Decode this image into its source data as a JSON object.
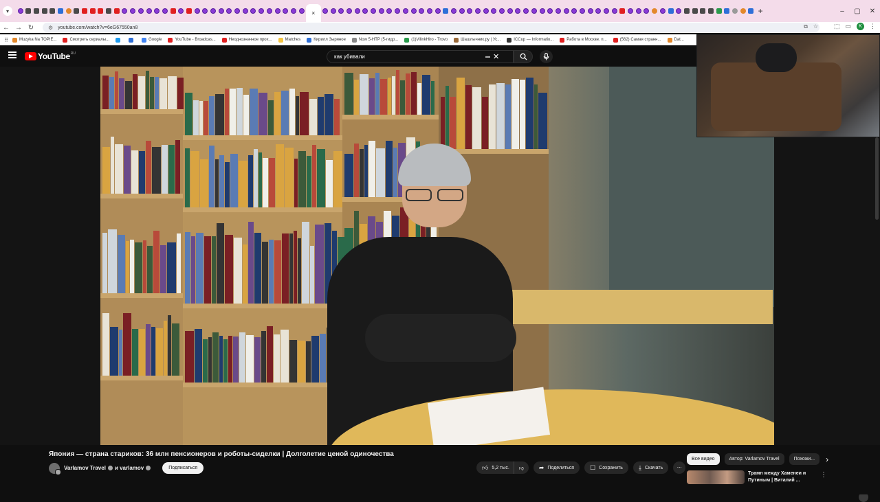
{
  "browser": {
    "tab_favicons": [
      "twitch",
      "doc",
      "doc",
      "doc",
      "doc",
      "blue",
      "orange",
      "doc",
      "yt",
      "yt",
      "yt",
      "doc",
      "yt",
      "twitch",
      "twitch",
      "twitch",
      "twitch",
      "twitch",
      "twitch",
      "yt",
      "twitch",
      "yt",
      "twitch",
      "twitch",
      "twitch",
      "twitch",
      "twitch",
      "twitch",
      "twitch",
      "twitch",
      "twitch",
      "twitch",
      "twitch",
      "twitch",
      "twitch",
      "twitch",
      "twitch",
      "twitch",
      "twitch",
      "twitch",
      "twitch",
      "twitch",
      "twitch",
      "twitch",
      "twitch",
      "twitch",
      "twitch",
      "twitch",
      "twitch",
      "twitch",
      "twitch",
      "blue",
      "twitch",
      "twitch",
      "twitch",
      "twitch",
      "twitch",
      "twitch",
      "twitch",
      "twitch",
      "twitch",
      "twitch",
      "twitch",
      "twitch",
      "twitch",
      "twitch",
      "twitch",
      "twitch",
      "twitch",
      "twitch",
      "twitch",
      "twitch",
      "twitch",
      "yt",
      "twitch",
      "twitch",
      "twitch",
      "orange",
      "twitch",
      "blue",
      "twitch",
      "doc",
      "doc",
      "doc",
      "doc",
      "green",
      "blue",
      "gray",
      "orange",
      "blue"
    ],
    "active_tab_close": "×",
    "new_tab": "+",
    "window_controls": [
      "–",
      "▢",
      "✕"
    ],
    "url": "youtube.com/watch?v=6eG67550an8",
    "profile_initial": "K",
    "bookmarks": [
      {
        "label": "Muzyka Na TOPIE...",
        "color": "#e3882b"
      },
      {
        "label": "Смотреть сериалы...",
        "color": "#e02020"
      },
      {
        "label": "",
        "color": "#1d9bf0"
      },
      {
        "label": "",
        "color": "#2e6fd8"
      },
      {
        "label": "Google",
        "color": "#4285f4"
      },
      {
        "label": "YouTube - Broadcas...",
        "color": "#e02020"
      },
      {
        "label": "Неоднозначное прох...",
        "color": "#e02020"
      },
      {
        "label": "Matches",
        "color": "#f5c542"
      },
      {
        "label": "Кирилл Зыряное",
        "color": "#2e6fd8"
      },
      {
        "label": "Now 5-HTP (5-гидр...",
        "color": "#888888"
      },
      {
        "label": "(1)VilinkHiro - Trovo",
        "color": "#2a9b4c"
      },
      {
        "label": "Шашлычник.ру | Ус...",
        "color": "#9a6a3a"
      },
      {
        "label": "ICCup — Informatio...",
        "color": "#333333"
      },
      {
        "label": "Работа в Москве. п...",
        "color": "#e02020"
      },
      {
        "label": "(562) Самая странн...",
        "color": "#e02020"
      },
      {
        "label": "Dat...",
        "color": "#e3882b"
      }
    ]
  },
  "youtube": {
    "logo_text": "YouTube",
    "country_code": "RU",
    "search": {
      "query": "как убивали"
    },
    "video": {
      "title": "Япония — страна стариков: 36 млн пенсионеров и роботы-сиделки | Долголетие ценой одиночества",
      "channel": "Varlamov Travel",
      "collab": "и varlamov",
      "subscribe_label": "Подписаться"
    },
    "actions": {
      "likes": "5,2 тыс.",
      "share": "Поделиться",
      "save": "Сохранить",
      "download": "Скачать"
    },
    "chips": [
      "Все видео",
      "Автор: Varlamov Travel",
      "Похожи..."
    ],
    "recommendation": {
      "title": "Трамп между Хаменеи и Путиным | Виталий ..."
    }
  }
}
